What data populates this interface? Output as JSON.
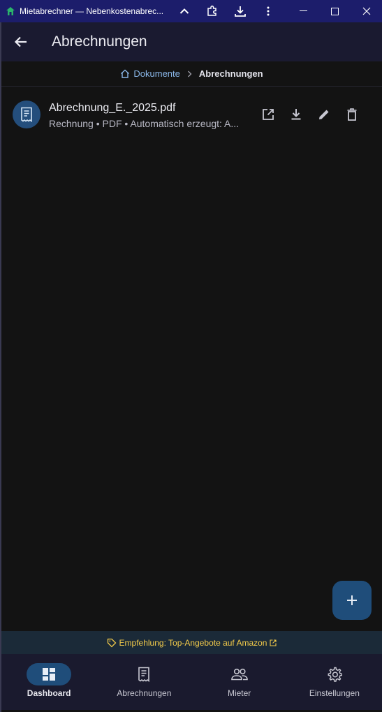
{
  "window": {
    "title": "Mietabrechner — Nebenkostenabrec...",
    "controls": [
      "chevron-up-icon",
      "extensions-icon",
      "download-icon",
      "more-vert-icon",
      "minimize-icon",
      "maximize-icon",
      "close-icon"
    ]
  },
  "appbar": {
    "title": "Abrechnungen",
    "back_icon": "arrow-back-icon"
  },
  "breadcrumb": {
    "root": "Dokumente",
    "current": "Abrechnungen"
  },
  "documents": [
    {
      "name": "Abrechnung_E._2025.pdf",
      "meta": "Rechnung • PDF • Automatisch erzeugt: A...",
      "icon": "receipt-icon",
      "actions": [
        "open-external-icon",
        "download-icon",
        "edit-icon",
        "delete-icon"
      ]
    }
  ],
  "fab": {
    "icon": "add-icon"
  },
  "promo": {
    "text": "Empfehlung: Top-Angebote auf Amazon"
  },
  "nav": {
    "items": [
      {
        "label": "Dashboard",
        "icon": "dashboard-icon",
        "active": true
      },
      {
        "label": "Abrechnungen",
        "icon": "receipt-icon",
        "active": false
      },
      {
        "label": "Mieter",
        "icon": "people-icon",
        "active": false
      },
      {
        "label": "Einstellungen",
        "icon": "settings-icon",
        "active": false
      }
    ]
  },
  "colors": {
    "titlebar": "#1c1d6b",
    "appbar": "#1a1a30",
    "background": "#131313",
    "accent": "#1f4d7a",
    "promo_text": "#f3cb4a",
    "link": "#8ab7e8"
  }
}
